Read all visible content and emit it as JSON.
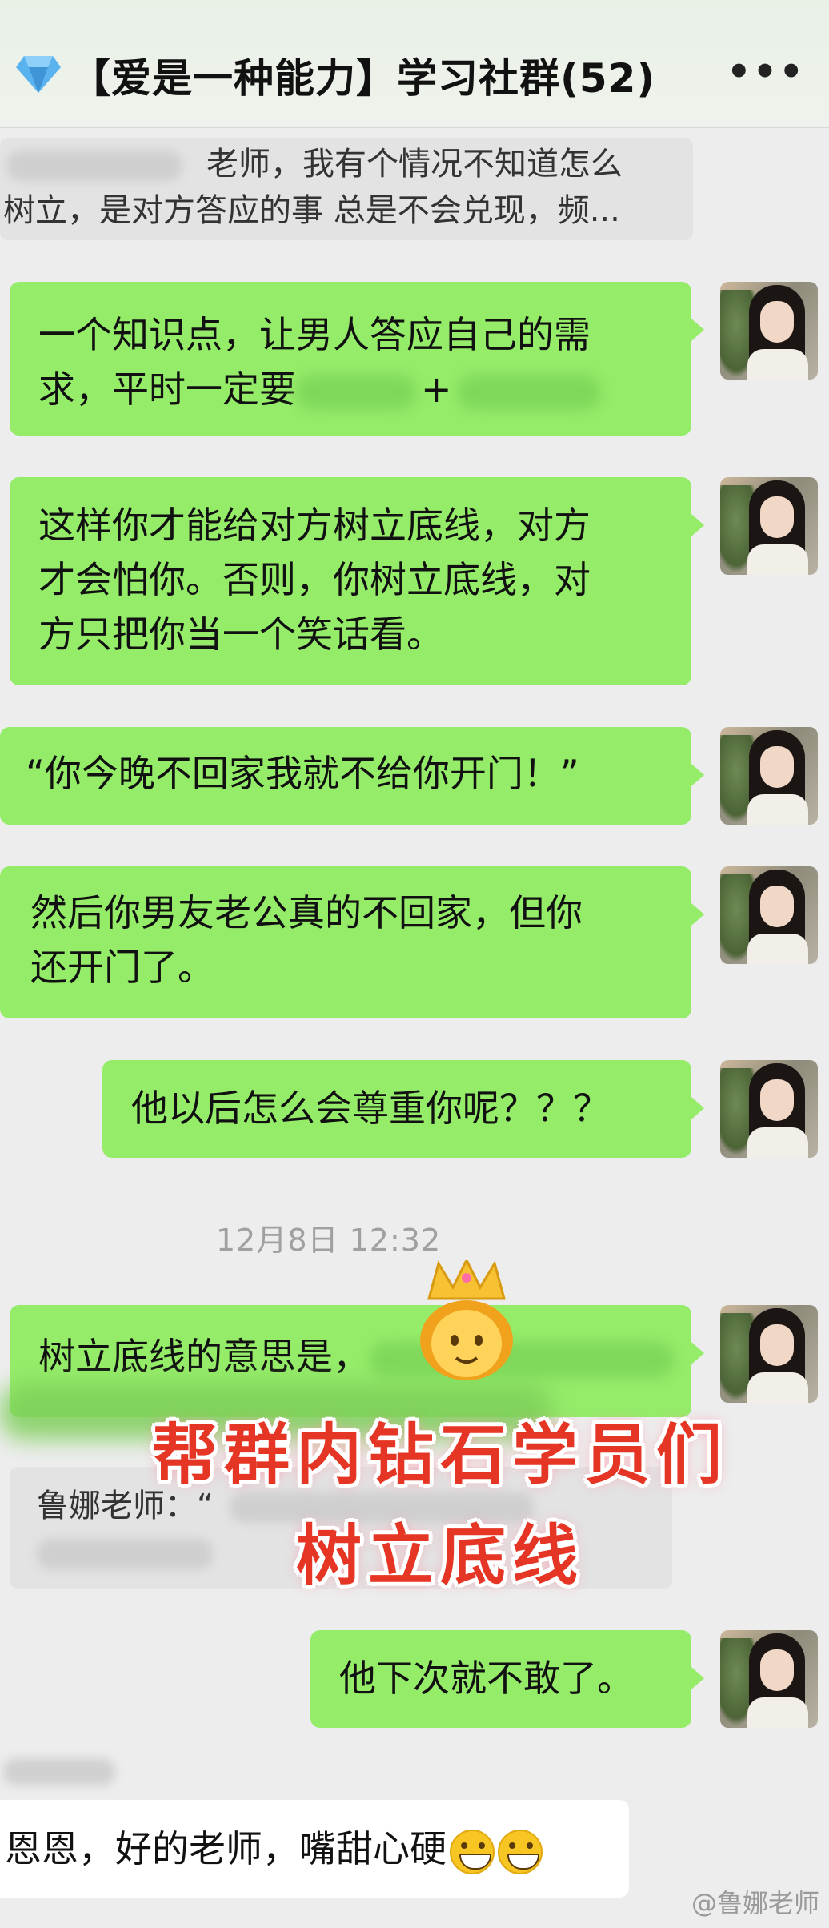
{
  "header": {
    "title": "【爱是一种能力】学习社群(52)",
    "icon": "diamond-icon",
    "more": "•••"
  },
  "quote_top": {
    "line1": "老师，我有个情况不知道怎么",
    "line2": "树立，是对方答应的事 总是不会兑现，频..."
  },
  "messages": [
    {
      "line1": "一个知识点，让男人答应自己的需",
      "line2a": "求，平时一定要",
      "line2b": "+"
    },
    {
      "line1": "这样你才能给对方树立底线，对方",
      "line2": "才会怕你。否则，你树立底线，对",
      "line3": "方只把你当一个笑话看。"
    },
    {
      "line1": "“你今晚不回家我就不给你开门！”"
    },
    {
      "line1": "然后你男友老公真的不回家，但你",
      "line2": "还开门了。"
    },
    {
      "line1": "他以后怎么会尊重你呢？？？"
    },
    {
      "line1": "树立底线的意思是，"
    },
    {
      "line1": "他下次就不敢了。"
    }
  ],
  "timestamp": "12月8日 12:32",
  "quote_bottom": {
    "sender": "鲁娜老师：“"
  },
  "overlay": {
    "line1": "帮群内钻石学员们",
    "line2": "树立底线"
  },
  "reply": {
    "text": "恩恩，好的老师，嘴甜心硬"
  },
  "watermark": "@鲁娜老师",
  "colors": {
    "bubble_green": "#95ec69",
    "overlay_red": "#e53524",
    "background": "#ededed"
  }
}
